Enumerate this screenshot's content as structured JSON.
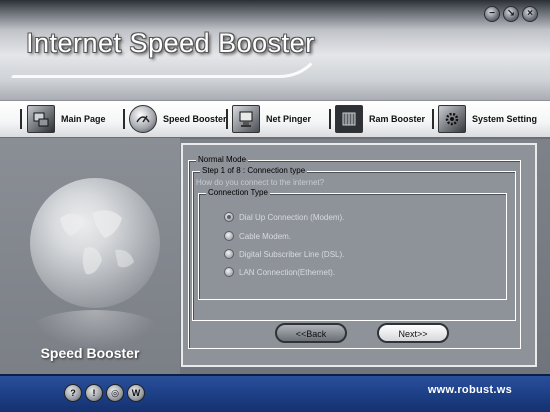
{
  "app": {
    "title": "Internet Speed Booster",
    "footer_url": "www.robust.ws",
    "panel_title": "Speed Booster"
  },
  "window_controls": {
    "minimize_icon": "minimize-icon",
    "restore_icon": "restore-icon",
    "close_icon": "close-icon"
  },
  "nav": {
    "items": [
      {
        "label": "Main Page",
        "icon": "main-page-icon"
      },
      {
        "label": "Speed Booster",
        "icon": "speed-booster-icon"
      },
      {
        "label": "Net Pinger",
        "icon": "net-pinger-icon"
      },
      {
        "label": "Ram Booster",
        "icon": "ram-booster-icon"
      },
      {
        "label": "System Setting",
        "icon": "system-setting-icon"
      }
    ],
    "active": "Speed Booster"
  },
  "wizard": {
    "mode_legend": "Normal Mode",
    "step_legend": "Step 1 of 8 : Connection type",
    "question": "How do you connect to the internet?",
    "group_legend": "Connection Type",
    "options": [
      {
        "label": "Dial Up Connection (Modem).",
        "selected": true
      },
      {
        "label": "Cable Modem.",
        "selected": false
      },
      {
        "label": "Digital  Subscriber Line (DSL).",
        "selected": false
      },
      {
        "label": "LAN Connection(Ethernet).",
        "selected": false
      }
    ],
    "back_label": "<<Back",
    "next_label": "Next>>"
  },
  "footer_icons": [
    "help-icon",
    "info-icon",
    "globe-icon",
    "web-icon"
  ],
  "colors": {
    "footer_bg": "#1c3f86",
    "panel_bg": "#8e9299",
    "nav_bg": "#f4f5f6"
  }
}
